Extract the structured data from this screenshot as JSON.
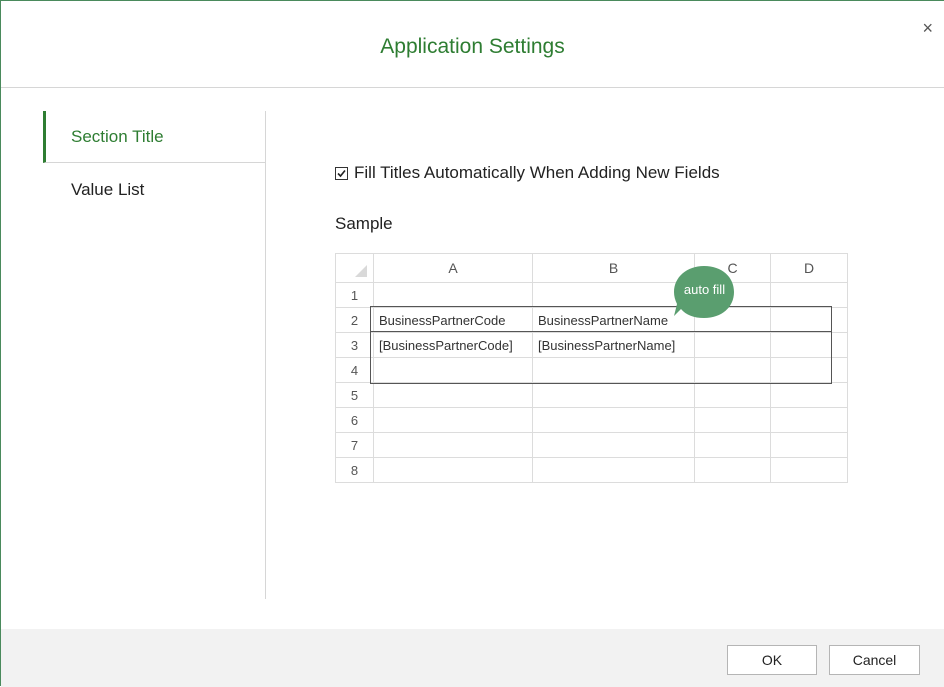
{
  "dialog": {
    "title": "Application Settings",
    "close_glyph": "×"
  },
  "sidebar": {
    "items": [
      {
        "label": "Section Title",
        "active": true
      },
      {
        "label": "Value List",
        "active": false
      }
    ]
  },
  "settings": {
    "fill_titles_label": "Fill Titles Automatically When Adding New Fields",
    "fill_titles_checked": true,
    "sample_label": "Sample"
  },
  "sample_grid": {
    "columns": [
      "A",
      "B",
      "C",
      "D"
    ],
    "rows": [
      {
        "num": "1",
        "cells": [
          "",
          "",
          "",
          ""
        ]
      },
      {
        "num": "2",
        "cells": [
          "BusinessPartnerCode",
          "BusinessPartnerName",
          "",
          ""
        ]
      },
      {
        "num": "3",
        "cells": [
          "[BusinessPartnerCode]",
          "[BusinessPartnerName]",
          "",
          ""
        ]
      },
      {
        "num": "4",
        "cells": [
          "",
          "",
          "",
          ""
        ]
      },
      {
        "num": "5",
        "cells": [
          "",
          "",
          "",
          ""
        ]
      },
      {
        "num": "6",
        "cells": [
          "",
          "",
          "",
          ""
        ]
      },
      {
        "num": "7",
        "cells": [
          "",
          "",
          "",
          ""
        ]
      },
      {
        "num": "8",
        "cells": [
          "",
          "",
          "",
          ""
        ]
      }
    ],
    "callout": "auto fill"
  },
  "footer": {
    "ok_label": "OK",
    "cancel_label": "Cancel"
  },
  "colors": {
    "accent_green": "#2e7d32",
    "callout_green": "#5a9e6f"
  }
}
